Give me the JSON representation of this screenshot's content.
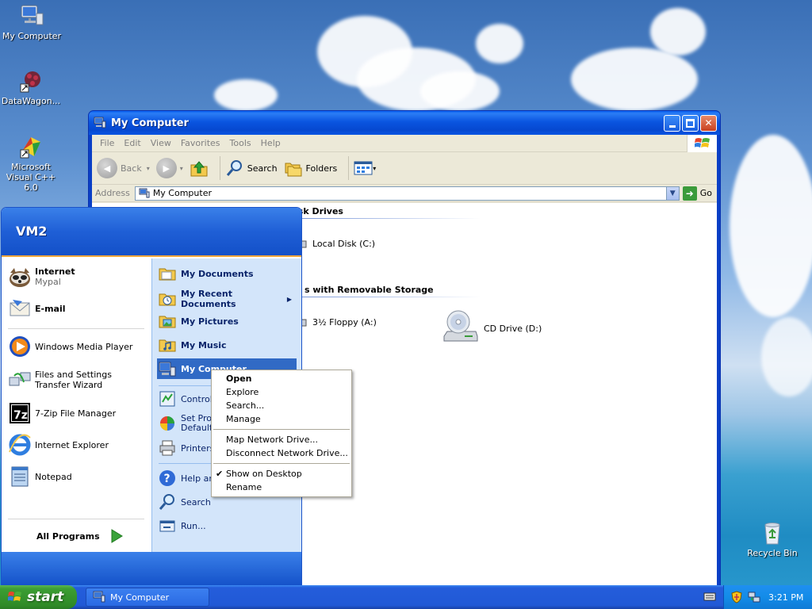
{
  "desktop": {
    "icons": [
      {
        "label": "My Computer"
      },
      {
        "label": "DataWagon..."
      },
      {
        "label": "Microsoft Visual C++ 6.0"
      },
      {
        "label": "Recycle Bin"
      }
    ]
  },
  "window": {
    "title": "My Computer",
    "menu": [
      "File",
      "Edit",
      "View",
      "Favorites",
      "Tools",
      "Help"
    ],
    "toolbar": {
      "back": "Back",
      "search": "Search",
      "folders": "Folders"
    },
    "address": {
      "label": "Address",
      "value": "My Computer",
      "go": "Go"
    },
    "groups": [
      {
        "header": "Hard Disk Drives",
        "visible_header": "isk Drives",
        "items": [
          {
            "label": "Local Disk (C:)"
          }
        ]
      },
      {
        "header": "Devices with Removable Storage",
        "visible_header": "s with Removable Storage",
        "items": [
          {
            "label": "3½ Floppy (A:)"
          },
          {
            "label": "CD Drive (D:)"
          }
        ]
      }
    ]
  },
  "start_menu": {
    "user": "VM2",
    "left_pinned": [
      {
        "label": "Internet",
        "sub": "Mypal"
      },
      {
        "label": "E-mail",
        "sub": ""
      }
    ],
    "left_recent": [
      {
        "label": "Windows Media Player"
      },
      {
        "label": "Files and Settings Transfer Wizard"
      },
      {
        "label": "7-Zip File Manager"
      },
      {
        "label": "Internet Explorer"
      },
      {
        "label": "Notepad"
      }
    ],
    "all_programs": "All Programs",
    "right": [
      {
        "label": "My Documents"
      },
      {
        "label": "My Recent Documents"
      },
      {
        "label": "My Pictures"
      },
      {
        "label": "My Music"
      },
      {
        "label": "My Computer"
      },
      {
        "label": "Control P"
      },
      {
        "label": "Set Prog Defaults"
      },
      {
        "label": "Printers"
      },
      {
        "label": "Help and"
      },
      {
        "label": "Search"
      },
      {
        "label": "Run..."
      }
    ]
  },
  "context_menu": {
    "items": [
      {
        "label": "Open"
      },
      {
        "label": "Explore"
      },
      {
        "label": "Search..."
      },
      {
        "label": "Manage"
      },
      {
        "label": "Map Network Drive..."
      },
      {
        "label": "Disconnect Network Drive..."
      },
      {
        "label": "Show on Desktop"
      },
      {
        "label": "Rename"
      }
    ]
  },
  "taskbar": {
    "start": "start",
    "task": "My Computer",
    "clock": "3:21 PM"
  }
}
